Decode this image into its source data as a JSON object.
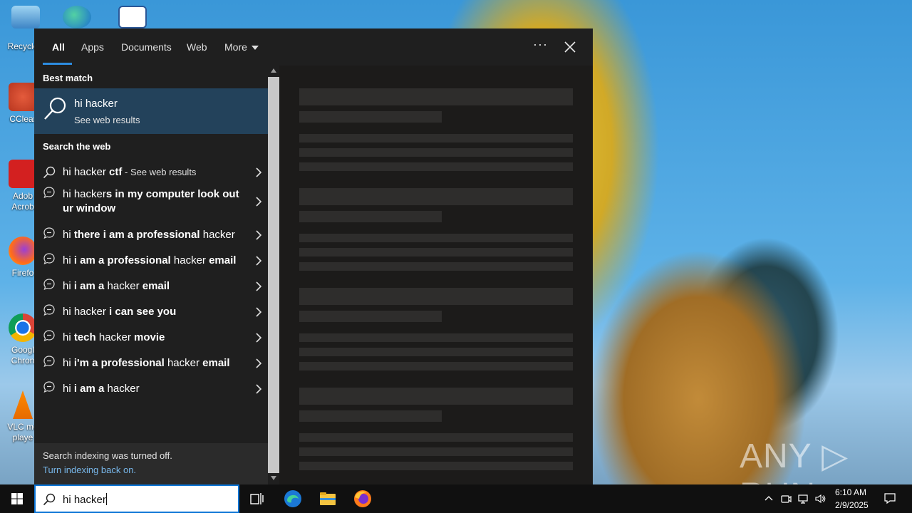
{
  "desktop": {
    "icons": [
      {
        "label": "Recycle"
      },
      {
        "label": "CClear"
      },
      {
        "label": "Adob Acrob"
      },
      {
        "label": "Firefo"
      },
      {
        "label": "Googl Chron"
      },
      {
        "label": "VLC me playe"
      }
    ]
  },
  "search": {
    "tabs": [
      {
        "label": "All"
      },
      {
        "label": "Apps"
      },
      {
        "label": "Documents"
      },
      {
        "label": "Web"
      },
      {
        "label": "More"
      }
    ],
    "ellipsis": "···",
    "best_match_heading": "Best match",
    "best_match": {
      "title": "hi hacker",
      "subtitle": "See web results"
    },
    "web_heading": "Search the web",
    "web_results": [
      {
        "parts": [
          {
            "t": "hi hacker ",
            "w": "n"
          },
          {
            "t": "ctf",
            "w": "b"
          },
          {
            "t": " - See web results",
            "w": "s"
          }
        ]
      },
      {
        "parts": [
          {
            "t": "hi hacker",
            "w": "n"
          },
          {
            "t": "s in my computer look out ur window",
            "w": "b"
          }
        ]
      },
      {
        "parts": [
          {
            "t": "hi ",
            "w": "n"
          },
          {
            "t": "there i am a professional",
            "w": "b"
          },
          {
            "t": " hacker",
            "w": "n"
          }
        ]
      },
      {
        "parts": [
          {
            "t": "hi ",
            "w": "n"
          },
          {
            "t": "i am a professional",
            "w": "b"
          },
          {
            "t": " hacker ",
            "w": "n"
          },
          {
            "t": "email",
            "w": "b"
          }
        ]
      },
      {
        "parts": [
          {
            "t": "hi ",
            "w": "n"
          },
          {
            "t": "i am a",
            "w": "b"
          },
          {
            "t": " hacker ",
            "w": "n"
          },
          {
            "t": "email",
            "w": "b"
          }
        ]
      },
      {
        "parts": [
          {
            "t": "hi hacker ",
            "w": "n"
          },
          {
            "t": "i can see you",
            "w": "b"
          }
        ]
      },
      {
        "parts": [
          {
            "t": "hi ",
            "w": "n"
          },
          {
            "t": "tech",
            "w": "b"
          },
          {
            "t": " hacker ",
            "w": "n"
          },
          {
            "t": "movie",
            "w": "b"
          }
        ]
      },
      {
        "parts": [
          {
            "t": "hi ",
            "w": "n"
          },
          {
            "t": "i'm a professional",
            "w": "b"
          },
          {
            "t": " hacker ",
            "w": "n"
          },
          {
            "t": "email",
            "w": "b"
          }
        ]
      },
      {
        "parts": [
          {
            "t": "hi ",
            "w": "n"
          },
          {
            "t": "i am a",
            "w": "b"
          },
          {
            "t": " hacker",
            "w": "n"
          }
        ]
      }
    ],
    "indexing_message": "Search indexing was turned off.",
    "indexing_link": "Turn indexing back on.",
    "query": "hi hacker"
  },
  "taskbar": {
    "clock_time": "6:10 AM",
    "clock_date": "2/9/2025"
  },
  "watermark": "ANY ▷ RUN",
  "colors": {
    "accent": "#2c8ce0",
    "selected_row": "#23425b",
    "panel": "#202020",
    "link": "#78b7ea"
  }
}
